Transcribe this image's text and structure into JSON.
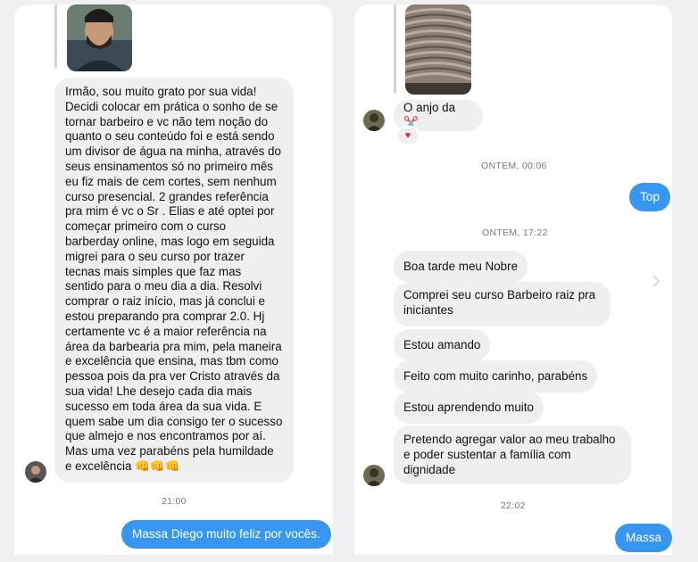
{
  "left": {
    "long_message": "Irmão, sou muito grato por sua vida! Decidi colocar em prática o sonho de se tornar barbeiro e vc não tem noção do quanto o seu conteúdo foi e está sendo um divisor de água na minha, através do seus ensinamentos só no primeiro mês eu fiz mais de cem cortes, sem nenhum curso presencial. 2 grandes referência pra mim é vc o Sr . Elias e até optei por começar primeiro com o curso barberday online, mas logo em seguida migrei para o seu curso por trazer tecnas mais simples que faz mas sentido para o meu dia a dia. Resolvi comprar o raiz início, mas já conclui e estou preparando pra comprar 2.0. Hj certamente vc é a maior referência na área da barbearia pra mim, pela maneira e excelência que ensina, mas tbm como pessoa pois da pra ver Cristo através da sua vida! Lhe desejo cada dia mais sucesso em toda área da sua vida. E quem sabe um dia consigo ter o sucesso que almejo e nos encontramos por aí. Mas uma vez parabéns pela humildade e excelência 👊👊👊",
    "timestamp": "21:00",
    "reply": "Massa Diego muito feliz por vocês."
  },
  "right": {
    "first_message": "O anjo da ✂️",
    "reaction": "♥",
    "timestamp_1": "ONTEM, 00:06",
    "reply_1": "Top",
    "timestamp_2": "ONTEM, 17:22",
    "messages": [
      "Boa tarde meu Nobre",
      "Comprei seu curso Barbeiro raiz pra iniciantes",
      "Estou amando",
      "Feito com muito carinho, parabéns",
      "Estou aprendendo muito",
      "Pretendo agregar valor ao meu trabalho e poder sustentar a família com dignidade"
    ],
    "timestamp_3": "22:02",
    "reply_2": "Massa"
  },
  "icons": {
    "nav_arrow": "chevron-right-icon"
  },
  "colors": {
    "outgoing_bubble": "#3797f0",
    "incoming_bubble": "#efefef",
    "background": "#f0f0f3"
  }
}
